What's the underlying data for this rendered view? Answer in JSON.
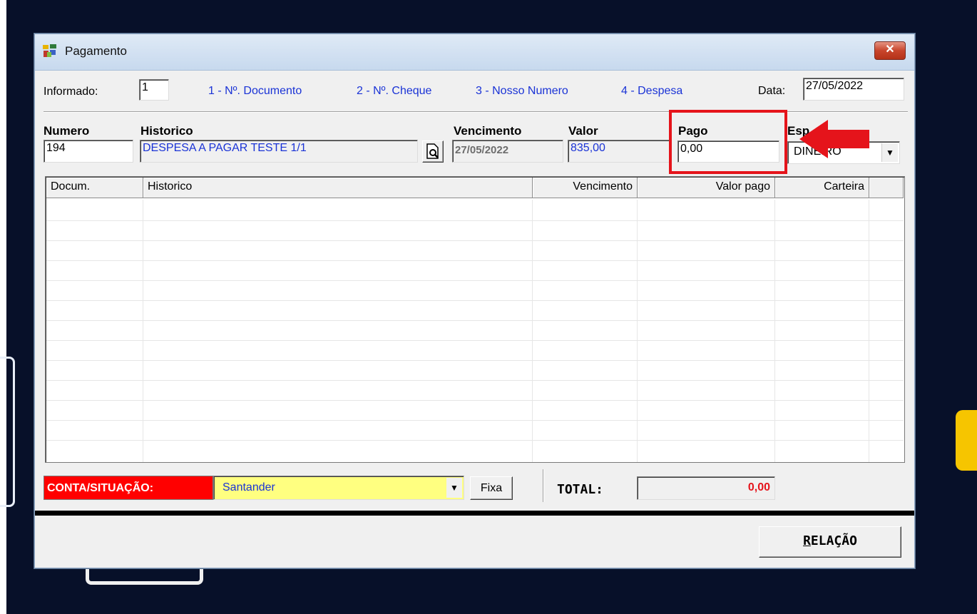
{
  "window": {
    "title": "Pagamento",
    "close_label": "✕",
    "app_icon": "colorful-app-icon"
  },
  "informado": {
    "label": "Informado:",
    "value": "1"
  },
  "options": [
    "1 - Nº. Documento",
    "2 - Nº. Cheque",
    "3 - Nosso Numero",
    "4 - Despesa"
  ],
  "data_field": {
    "label": "Data:",
    "value": "27/05/2022"
  },
  "fields": {
    "numero": {
      "label": "Numero",
      "value": "194"
    },
    "historico": {
      "label": "Historico",
      "value": "DESPESA A PAGAR TESTE 1/1"
    },
    "vencimento": {
      "label": "Vencimento",
      "value": "27/05/2022"
    },
    "valor": {
      "label": "Valor",
      "value": "835,00"
    },
    "pago": {
      "label": "Pago",
      "value": "0,00"
    },
    "especie": {
      "label": "Esp",
      "value": "DIN",
      "value_tail": "EIRO"
    }
  },
  "table": {
    "columns": [
      "Docum.",
      "Historico",
      "Vencimento",
      "Valor pago",
      "Carteira"
    ],
    "rows": []
  },
  "footer": {
    "conta_label": "CONTA/SITUAÇÃO:",
    "conta_value": "Santander",
    "fixa_label": "Fixa",
    "total_label": "TOTAL:",
    "total_value": "0,00",
    "relacao_label": "RELAÇÃO"
  },
  "colors": {
    "accent_red": "#e5141b",
    "link_blue": "#1a33d6",
    "conta_yellow": "#ffff80"
  }
}
